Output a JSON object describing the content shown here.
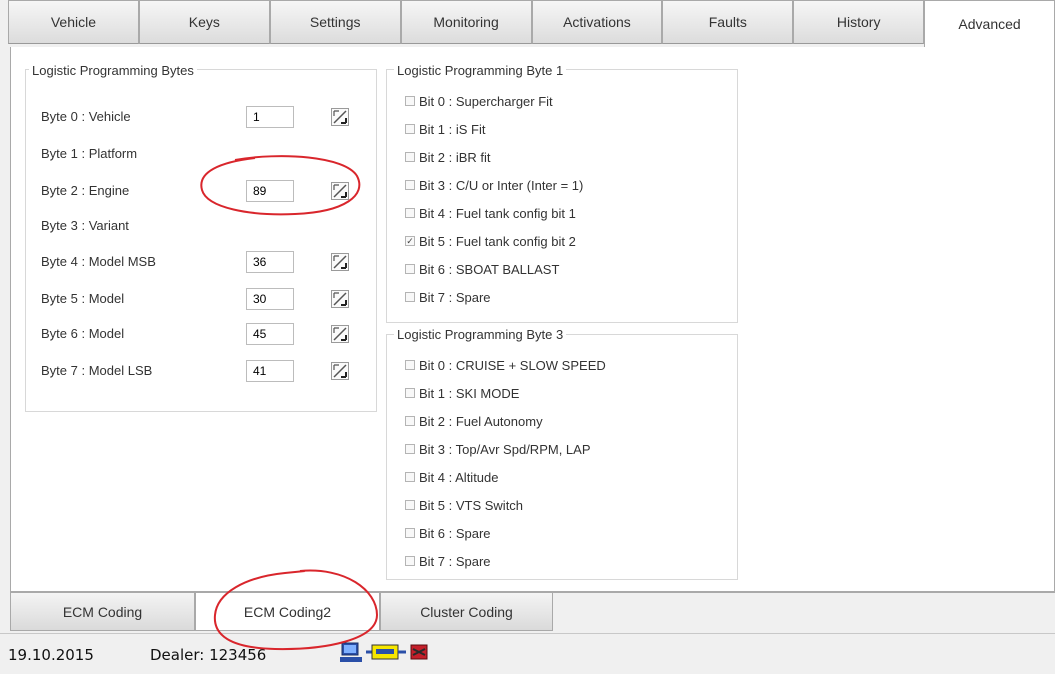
{
  "tabs": [
    "Vehicle",
    "Keys",
    "Settings",
    "Monitoring",
    "Activations",
    "Faults",
    "History",
    "Advanced"
  ],
  "active_tab": "Advanced",
  "left_group": {
    "title": "Logistic Programming Bytes",
    "rows": [
      {
        "label": "Byte 0 : Vehicle",
        "value": "1",
        "has_input": true
      },
      {
        "label": "Byte 1 : Platform",
        "value": "",
        "has_input": false
      },
      {
        "label": "Byte 2 : Engine",
        "value": "89",
        "has_input": true
      },
      {
        "label": "Byte 3 : Variant",
        "value": "",
        "has_input": false
      },
      {
        "label": "Byte 4 : Model MSB",
        "value": "36",
        "has_input": true
      },
      {
        "label": "Byte 5 : Model",
        "value": "30",
        "has_input": true
      },
      {
        "label": "Byte 6 : Model",
        "value": "45",
        "has_input": true
      },
      {
        "label": "Byte 7 : Model LSB",
        "value": "41",
        "has_input": true
      }
    ]
  },
  "byte1_group": {
    "title": "Logistic Programming Byte 1",
    "bits": [
      {
        "label": "Bit 0 : Supercharger Fit",
        "checked": false
      },
      {
        "label": "Bit 1 : iS Fit",
        "checked": false
      },
      {
        "label": "Bit 2 : iBR fit",
        "checked": false
      },
      {
        "label": "Bit 3 : C/U or Inter (Inter = 1)",
        "checked": false
      },
      {
        "label": "Bit 4 : Fuel tank config bit 1",
        "checked": false
      },
      {
        "label": "Bit 5 : Fuel tank config bit 2",
        "checked": true
      },
      {
        "label": "Bit 6 : SBOAT BALLAST",
        "checked": false
      },
      {
        "label": "Bit 7 : Spare",
        "checked": false
      }
    ]
  },
  "byte3_group": {
    "title": "Logistic Programming Byte 3",
    "bits": [
      {
        "label": "Bit 0 : CRUISE + SLOW SPEED",
        "checked": false
      },
      {
        "label": "Bit 1 : SKI MODE",
        "checked": false
      },
      {
        "label": "Bit 2 : Fuel Autonomy",
        "checked": false
      },
      {
        "label": "Bit 3 : Top/Avr Spd/RPM, LAP",
        "checked": false
      },
      {
        "label": "Bit 4 : Altitude",
        "checked": false
      },
      {
        "label": "Bit 5 : VTS Switch",
        "checked": false
      },
      {
        "label": "Bit 6 : Spare",
        "checked": false
      },
      {
        "label": "Bit 7 : Spare",
        "checked": false
      }
    ]
  },
  "bottom_tabs": [
    "ECM Coding",
    "ECM Coding2",
    "Cluster Coding"
  ],
  "active_bottom_tab": "ECM Coding2",
  "status": {
    "date": "19.10.2015",
    "dealer": "Dealer: 123456",
    "icon_names": [
      "computer-icon",
      "connection-badge-icon",
      "car-engine-icon"
    ]
  },
  "colors": {
    "annotation": "#d9262c",
    "check": "#444444"
  }
}
